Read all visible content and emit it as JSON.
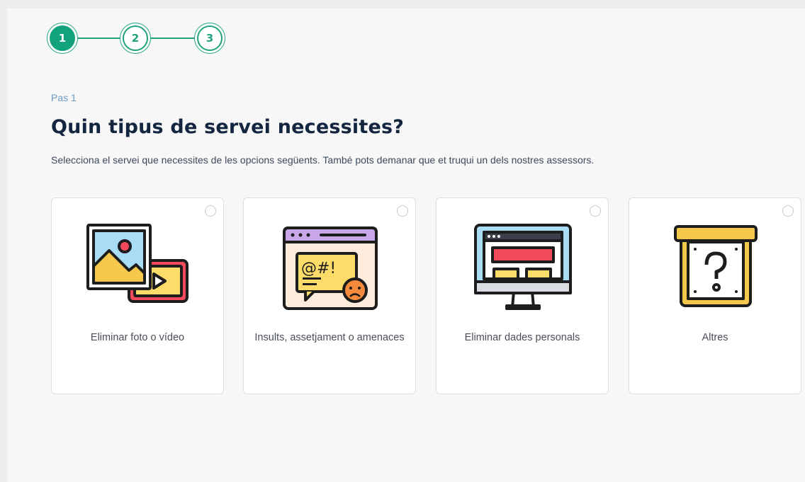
{
  "stepper": {
    "steps": [
      {
        "number": "1",
        "state": "active"
      },
      {
        "number": "2",
        "state": "pending"
      },
      {
        "number": "3",
        "state": "pending"
      }
    ],
    "accent_color": "#12a37c"
  },
  "step_label": "Pas 1",
  "title": "Quin tipus de servei necessites?",
  "subtitle": "Selecciona el servei que necessites de les opcions següents. També pots demanar que et truqui un dels nostres assessors.",
  "options": [
    {
      "label": "Eliminar foto o vídeo",
      "icon": "photo-video-icon",
      "selected": false
    },
    {
      "label": "Insults, assetjament o amenaces",
      "icon": "insult-window-icon",
      "selected": false
    },
    {
      "label": "Eliminar dades personals",
      "icon": "monitor-data-icon",
      "selected": false
    },
    {
      "label": "Altres",
      "icon": "question-box-icon",
      "selected": false
    }
  ]
}
